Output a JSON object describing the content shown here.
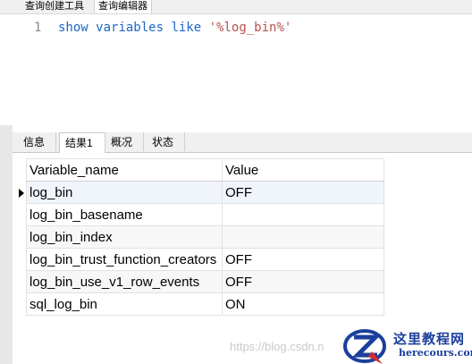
{
  "top_tabs": [
    "查询创建工具",
    "查询编辑器"
  ],
  "editor": {
    "line_number": "1",
    "code": {
      "kw1": "show",
      "kw2": "variables",
      "kw3": "like",
      "string": "'%log_bin%'"
    }
  },
  "result_tabs": [
    "信息",
    "结果1",
    "概况",
    "状态"
  ],
  "grid": {
    "columns": [
      "Variable_name",
      "Value"
    ],
    "rows": [
      {
        "name": "log_bin",
        "value": "OFF"
      },
      {
        "name": "log_bin_basename",
        "value": ""
      },
      {
        "name": "log_bin_index",
        "value": ""
      },
      {
        "name": "log_bin_trust_function_creators",
        "value": "OFF"
      },
      {
        "name": "log_bin_use_v1_row_events",
        "value": "OFF"
      },
      {
        "name": "sql_log_bin",
        "value": "ON"
      }
    ]
  },
  "watermark": {
    "url": "https://blog.csdn.n",
    "logo_cn": "这里教程网",
    "logo_en": "herecours.com"
  },
  "colors": {
    "keyword": "#1d66c9",
    "string": "#b5524b",
    "logo": "#1c3f9c"
  }
}
